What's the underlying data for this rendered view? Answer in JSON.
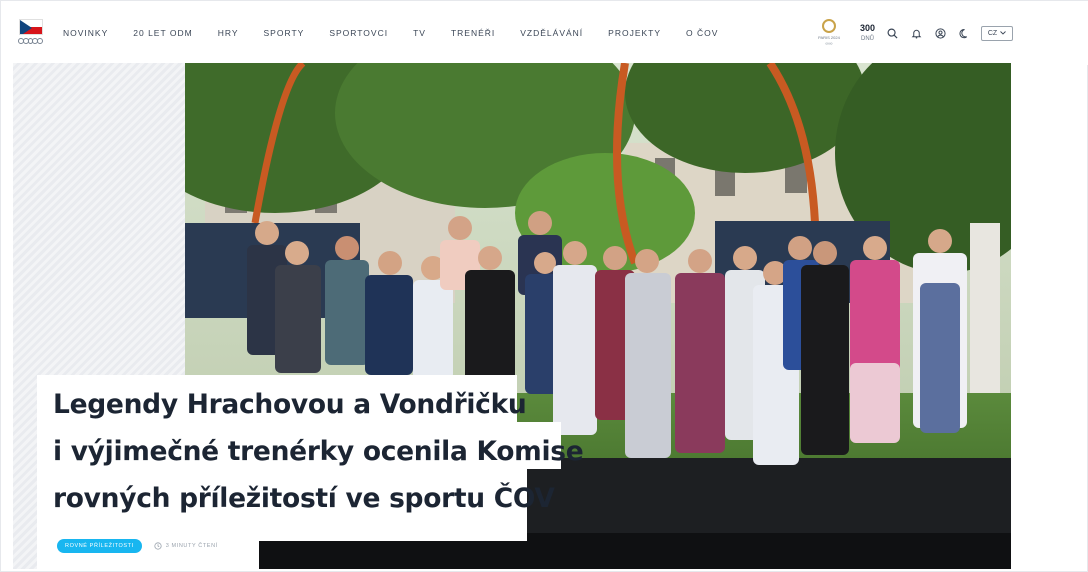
{
  "header": {
    "nav": [
      "NOVINKY",
      "20 LET ODM",
      "HRY",
      "SPORTY",
      "SPORTOVCI",
      "TV",
      "TRENÉŘI",
      "VZDĚLÁVÁNÍ",
      "PROJEKTY",
      "O ČOV"
    ],
    "games_logo_text": "PARIS 2024",
    "counter_value": "300",
    "counter_unit": "DNŮ",
    "language": "CZ",
    "icons": [
      "search-icon",
      "bell-icon",
      "user-icon",
      "moon-icon",
      "chevron-down-icon"
    ]
  },
  "article": {
    "headline_lines": [
      "Legendy Hrachovou a Vondřičku",
      "i výjimečné trenérky ocenila Komise",
      "rovných příležitostí ve sportu ČOV"
    ],
    "tag": "ROVNÉ PŘÍLEŽITOSTI",
    "read_time": "3 MINUTY ČTENÍ"
  },
  "colors": {
    "accent": "#18b6f0",
    "flag_blue": "#11457e",
    "flag_red": "#d7141a",
    "text": "#1c2533"
  }
}
